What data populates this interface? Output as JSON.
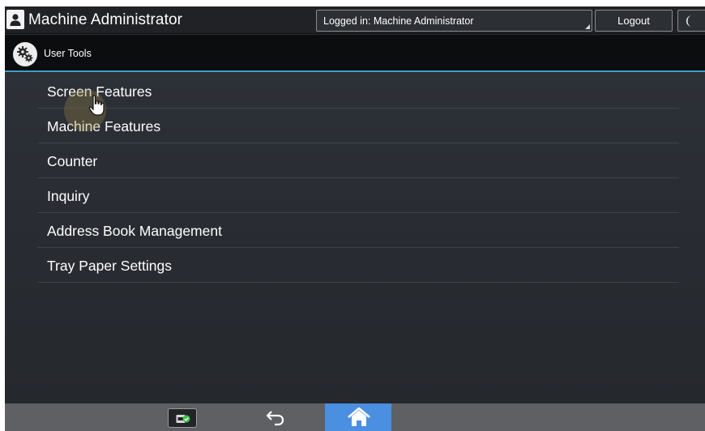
{
  "header": {
    "title": "Machine Administrator",
    "logged_in": "Logged in: Machine Administrator",
    "logout_label": "Logout",
    "icons": [
      "user-icon",
      "energy-saver-icon"
    ]
  },
  "subheader": {
    "title": "User Tools",
    "icon": "gear-icon"
  },
  "menu": {
    "items": [
      {
        "label": "Screen Features"
      },
      {
        "label": "Machine Features"
      },
      {
        "label": "Counter"
      },
      {
        "label": "Inquiry"
      },
      {
        "label": "Address Book Management"
      },
      {
        "label": "Tray Paper Settings"
      }
    ]
  },
  "bottombar": {
    "icons": [
      "status-check-icon",
      "back-arrow-icon",
      "home-icon"
    ]
  },
  "colors": {
    "accent_line": "#3aa0c9",
    "home_button": "#4a8fe0",
    "background": "#2a2d33"
  }
}
